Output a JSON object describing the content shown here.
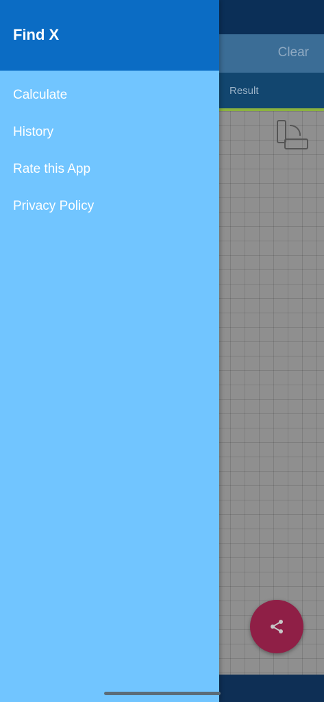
{
  "app": {
    "title": "Find X"
  },
  "drawer": {
    "items": [
      {
        "label": "Calculate"
      },
      {
        "label": "History"
      },
      {
        "label": "Rate this App"
      },
      {
        "label": "Privacy Policy"
      }
    ]
  },
  "background": {
    "toolbar": {
      "clear_label": "Clear"
    },
    "tabs": {
      "result_label": "Result"
    },
    "icons": {
      "rotate": "screen-rotation-icon",
      "share": "share-icon"
    }
  },
  "colors": {
    "drawer_bg": "#71c5ff",
    "drawer_header": "#0b6cc4",
    "fab": "#8f1f46",
    "tab_underline": "#8bb23f"
  }
}
